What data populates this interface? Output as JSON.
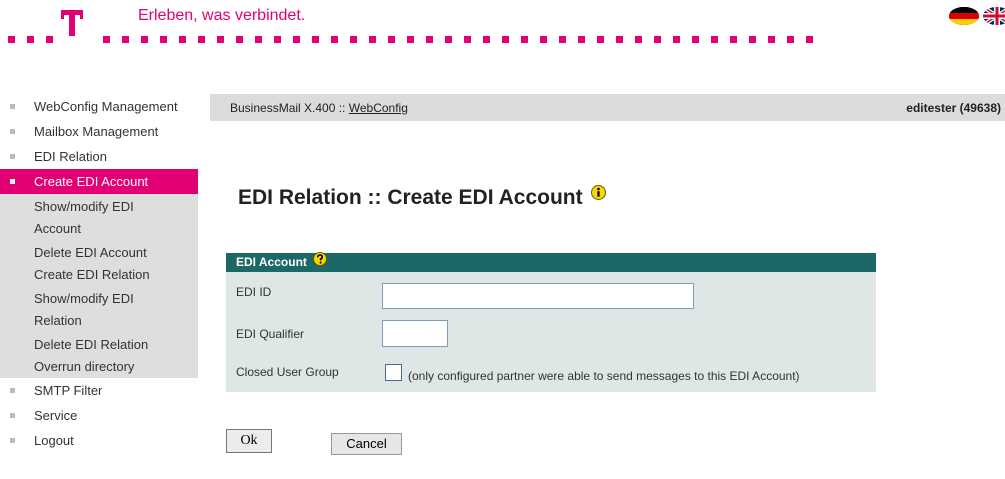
{
  "header": {
    "slogan": "Erleben, was verbindet.",
    "logo_letter": "T",
    "brand_color": "#e20074",
    "languages": [
      "de-flag-icon",
      "uk-flag-icon"
    ]
  },
  "sidebar": {
    "items": [
      {
        "label": "WebConfig Management"
      },
      {
        "label": "Mailbox Management"
      },
      {
        "label": "EDI Relation"
      },
      {
        "label": "Create EDI Account",
        "active": true
      }
    ],
    "subitems": [
      {
        "label": "Show/modify EDI Account"
      },
      {
        "label": "Delete EDI Account"
      },
      {
        "label": "Create EDI Relation"
      },
      {
        "label": "Show/modify EDI Relation"
      },
      {
        "label": "Delete EDI Relation"
      },
      {
        "label": "Overrun directory"
      }
    ],
    "bottom_items": [
      {
        "label": "SMTP Filter"
      },
      {
        "label": "Service"
      },
      {
        "label": "Logout"
      }
    ]
  },
  "breadcrumb": {
    "prefix": "BusinessMail X.400 :: ",
    "link": "WebConfig"
  },
  "user": "editester (49638)",
  "page_title": "EDI Relation :: Create EDI Account",
  "form": {
    "heading": "EDI Account",
    "fields": {
      "edi_id": {
        "label": "EDI ID",
        "value": ""
      },
      "edi_qualifier": {
        "label": "EDI Qualifier",
        "value": ""
      },
      "closed_user_group": {
        "label": "Closed User Group",
        "checked": false,
        "note": "(only configured partner were able to send messages to this EDI Account)"
      }
    }
  },
  "buttons": {
    "ok": "Ok",
    "cancel": "Cancel"
  },
  "colors": {
    "magenta": "#e20074",
    "panel_header": "#1b6866",
    "panel_bg": "#dee6e6",
    "crumb_bg": "#dcdcdc"
  }
}
